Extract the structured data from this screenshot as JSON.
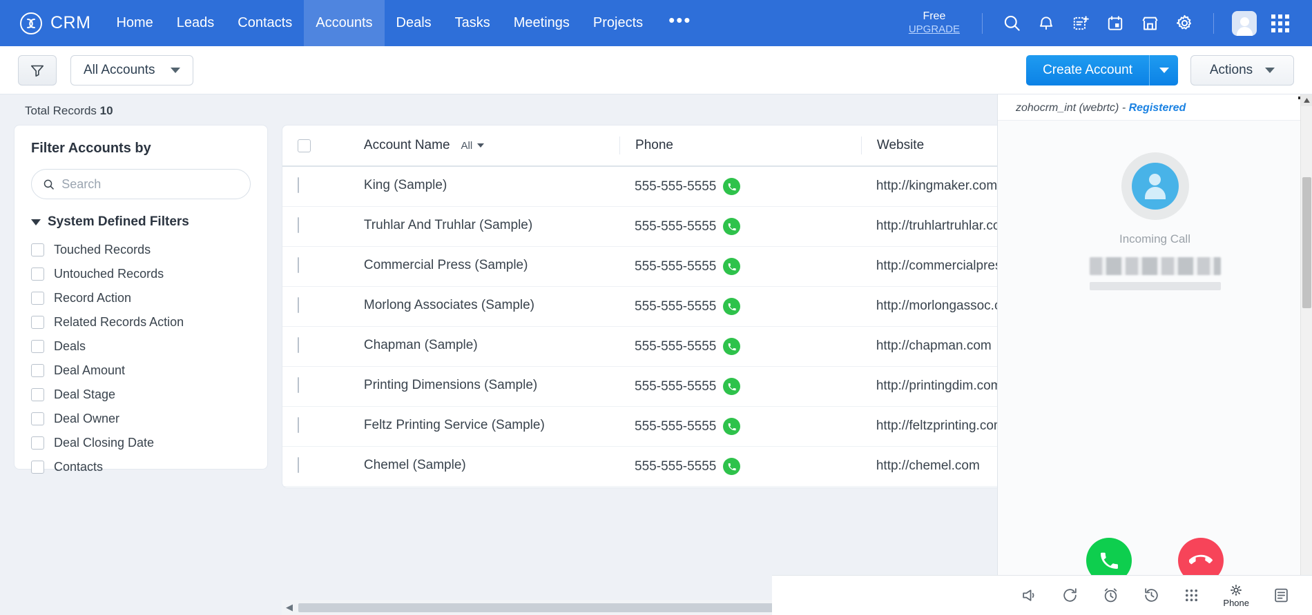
{
  "topnav": {
    "brand": "CRM",
    "items": [
      {
        "label": "Home",
        "active": false
      },
      {
        "label": "Leads",
        "active": false
      },
      {
        "label": "Contacts",
        "active": false
      },
      {
        "label": "Accounts",
        "active": true
      },
      {
        "label": "Deals",
        "active": false
      },
      {
        "label": "Tasks",
        "active": false
      },
      {
        "label": "Meetings",
        "active": false
      },
      {
        "label": "Projects",
        "active": false
      }
    ],
    "more_label": "•••",
    "plan_name": "Free",
    "plan_upgrade": "UPGRADE",
    "icons": [
      "search-icon",
      "bell-icon",
      "note-add-icon",
      "calendar-icon",
      "marketplace-icon",
      "gear-icon",
      "avatar",
      "app-grid-icon"
    ],
    "accent": "#2e6fd9"
  },
  "toolbar": {
    "filter_icon": "funnel-icon",
    "view_name": "All Accounts",
    "create_label": "Create Account",
    "actions_label": "Actions",
    "create_accent": "#0b82e6"
  },
  "list": {
    "total_records_label": "Total Records",
    "total_records_count": "10",
    "columns": [
      "Account Name",
      "Phone",
      "Website"
    ],
    "name_scope": "All",
    "rows": [
      {
        "name": "King (Sample)",
        "phone": "555-555-5555",
        "website": "http://kingmaker.com"
      },
      {
        "name": "Truhlar And Truhlar (Sample)",
        "phone": "555-555-5555",
        "website": "http://truhlartruhlar.com/"
      },
      {
        "name": "Commercial Press (Sample)",
        "phone": "555-555-5555",
        "website": "http://commercialpress.com"
      },
      {
        "name": "Morlong Associates (Sample)",
        "phone": "555-555-5555",
        "website": "http://morlongassoc.com/"
      },
      {
        "name": "Chapman (Sample)",
        "phone": "555-555-5555",
        "website": "http://chapman.com"
      },
      {
        "name": "Printing Dimensions (Sample)",
        "phone": "555-555-5555",
        "website": "http://printingdim.com"
      },
      {
        "name": "Feltz Printing Service (Sample)",
        "phone": "555-555-5555",
        "website": "http://feltzprinting.com"
      },
      {
        "name": "Chemel (Sample)",
        "phone": "555-555-5555",
        "website": "http://chemel.com"
      }
    ]
  },
  "filters": {
    "title": "Filter Accounts by",
    "search_placeholder": "Search",
    "search_value": "",
    "group_label": "System Defined Filters",
    "items": [
      {
        "label": "Touched Records",
        "checked": false
      },
      {
        "label": "Untouched Records",
        "checked": false
      },
      {
        "label": "Record Action",
        "checked": false
      },
      {
        "label": "Related Records Action",
        "checked": false
      },
      {
        "label": "Deals",
        "checked": false
      },
      {
        "label": "Deal Amount",
        "checked": false
      },
      {
        "label": "Deal Stage",
        "checked": false
      },
      {
        "label": "Deal Owner",
        "checked": false
      },
      {
        "label": "Deal Closing Date",
        "checked": false
      },
      {
        "label": "Contacts",
        "checked": false
      }
    ]
  },
  "softphone": {
    "account": "zohocrm_int (webrtc) - ",
    "status": "Registered",
    "call_state": "Incoming Call",
    "caller_redacted": true,
    "accept_icon": "phone-accept-icon",
    "decline_icon": "phone-decline-icon",
    "accept_color": "#0ece4e",
    "decline_color": "#f74459"
  },
  "footer": {
    "items": [
      {
        "icon": "announcement-icon",
        "label": ""
      },
      {
        "icon": "refresh-icon",
        "label": ""
      },
      {
        "icon": "alarm-icon",
        "label": ""
      },
      {
        "icon": "history-icon",
        "label": ""
      },
      {
        "icon": "dialpad-icon",
        "label": ""
      },
      {
        "icon": "phone-settings-icon",
        "label": "Phone"
      },
      {
        "icon": "notes-icon",
        "label": ""
      }
    ]
  }
}
